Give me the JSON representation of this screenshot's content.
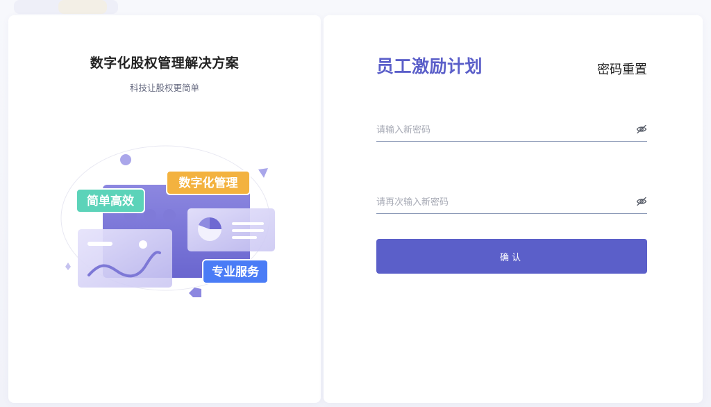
{
  "brand": {
    "headline": "数字化股权管理解决方案",
    "tagline": "科技让股权更简单",
    "tags": {
      "simple": "简单高效",
      "digital": "数字化管理",
      "service": "专业服务"
    }
  },
  "form": {
    "product_title": "员工激励计划",
    "page_title": "密码重置",
    "new_password_placeholder": "请输入新密码",
    "confirm_password_placeholder": "请再次输入新密码",
    "confirm_label": "确认"
  },
  "icons": {
    "password_toggle": "eye-off-icon"
  },
  "colors": {
    "accent": "#5b5fc9",
    "tag_green": "#5cd3b9",
    "tag_orange": "#f3b23f",
    "tag_blue": "#4a7cf6"
  }
}
